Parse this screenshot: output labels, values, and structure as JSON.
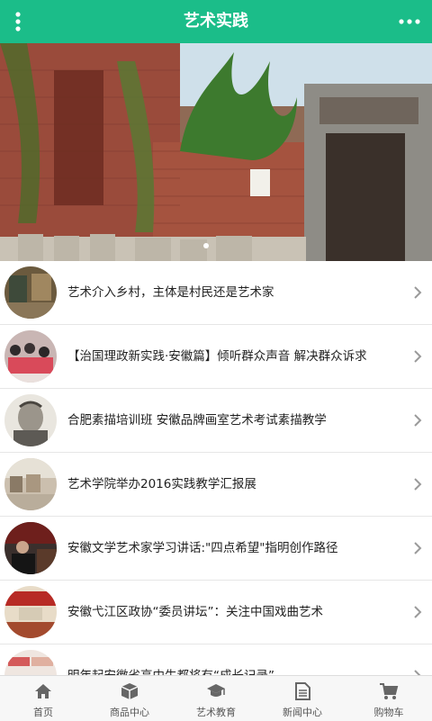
{
  "header": {
    "title": "艺术实践",
    "menu_icon": "vertical-dots-icon",
    "more_icon": "horizontal-dots-icon"
  },
  "banner": {
    "indicator_count": 1,
    "active_index": 0
  },
  "list": {
    "items": [
      {
        "title": "艺术介入乡村，主体是村民还是艺术家"
      },
      {
        "title": "【治国理政新实践·安徽篇】倾听群众声音 解决群众诉求"
      },
      {
        "title": "合肥素描培训班 安徽品牌画室艺术考试素描教学"
      },
      {
        "title": "艺术学院举办2016实践教学汇报展"
      },
      {
        "title": "安徽文学艺术家学习讲话:\"四点希望\"指明创作路径"
      },
      {
        "title": "安徽弋江区政协“委员讲坛”：关注中国戏曲艺术"
      },
      {
        "title": "明年起安徽省高中生都将有“成长记录”"
      }
    ]
  },
  "footer": {
    "tabs": [
      {
        "label": "首页",
        "icon": "home-icon"
      },
      {
        "label": "商品中心",
        "icon": "cube-icon"
      },
      {
        "label": "艺术教育",
        "icon": "graduation-cap-icon"
      },
      {
        "label": "新闻中心",
        "icon": "document-icon"
      },
      {
        "label": "购物车",
        "icon": "cart-icon"
      }
    ]
  },
  "colors": {
    "header_bg": "#1bbd89",
    "footer_bg": "#f7f7f7",
    "icon_gray": "#666666"
  }
}
